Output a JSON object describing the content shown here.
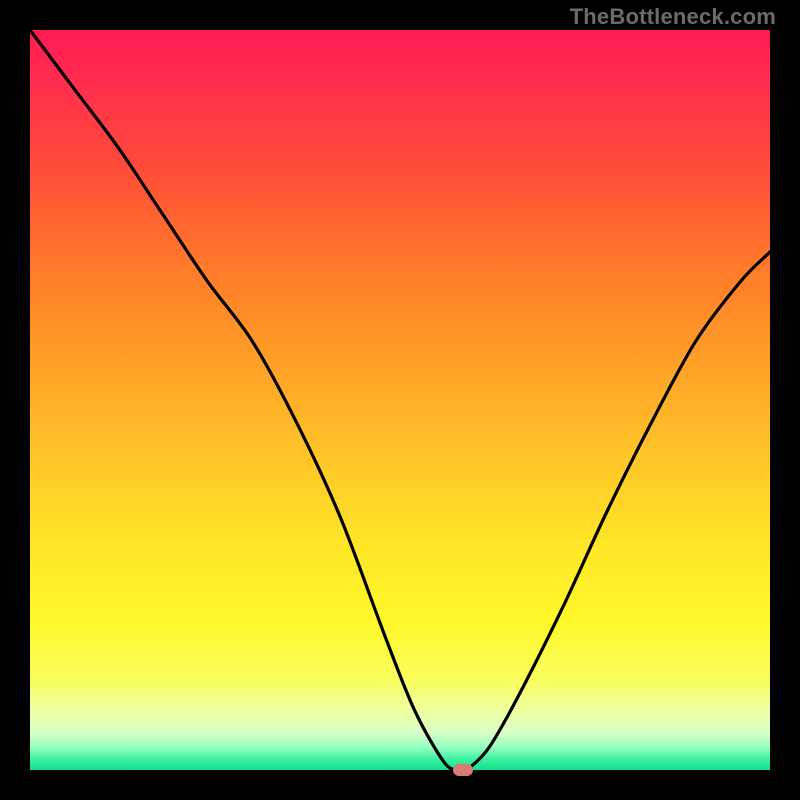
{
  "watermark": "TheBottleneck.com",
  "chart_data": {
    "type": "line",
    "title": "",
    "xlabel": "",
    "ylabel": "",
    "xlim": [
      0,
      100
    ],
    "ylim": [
      0,
      100
    ],
    "grid": false,
    "series": [
      {
        "name": "bottleneck-curve",
        "x": [
          0,
          6,
          12,
          18,
          24,
          30,
          36,
          42,
          48,
          52,
          56,
          58,
          59,
          62,
          66,
          72,
          78,
          84,
          90,
          96,
          100
        ],
        "y": [
          100,
          92,
          84,
          75,
          66,
          58,
          47,
          34,
          18,
          8,
          1,
          0,
          0,
          3,
          10,
          22,
          35,
          47,
          58,
          66,
          70
        ]
      }
    ],
    "marker": {
      "x": 58.5,
      "y": 0,
      "color": "#d97a74"
    },
    "background_gradient": {
      "type": "vertical",
      "stops": [
        {
          "pos": 0.0,
          "color": "#ff1a52"
        },
        {
          "pos": 0.32,
          "color": "#ff7a2a"
        },
        {
          "pos": 0.7,
          "color": "#ffe628"
        },
        {
          "pos": 0.92,
          "color": "#eeffa0"
        },
        {
          "pos": 1.0,
          "color": "#10e090"
        }
      ]
    }
  }
}
